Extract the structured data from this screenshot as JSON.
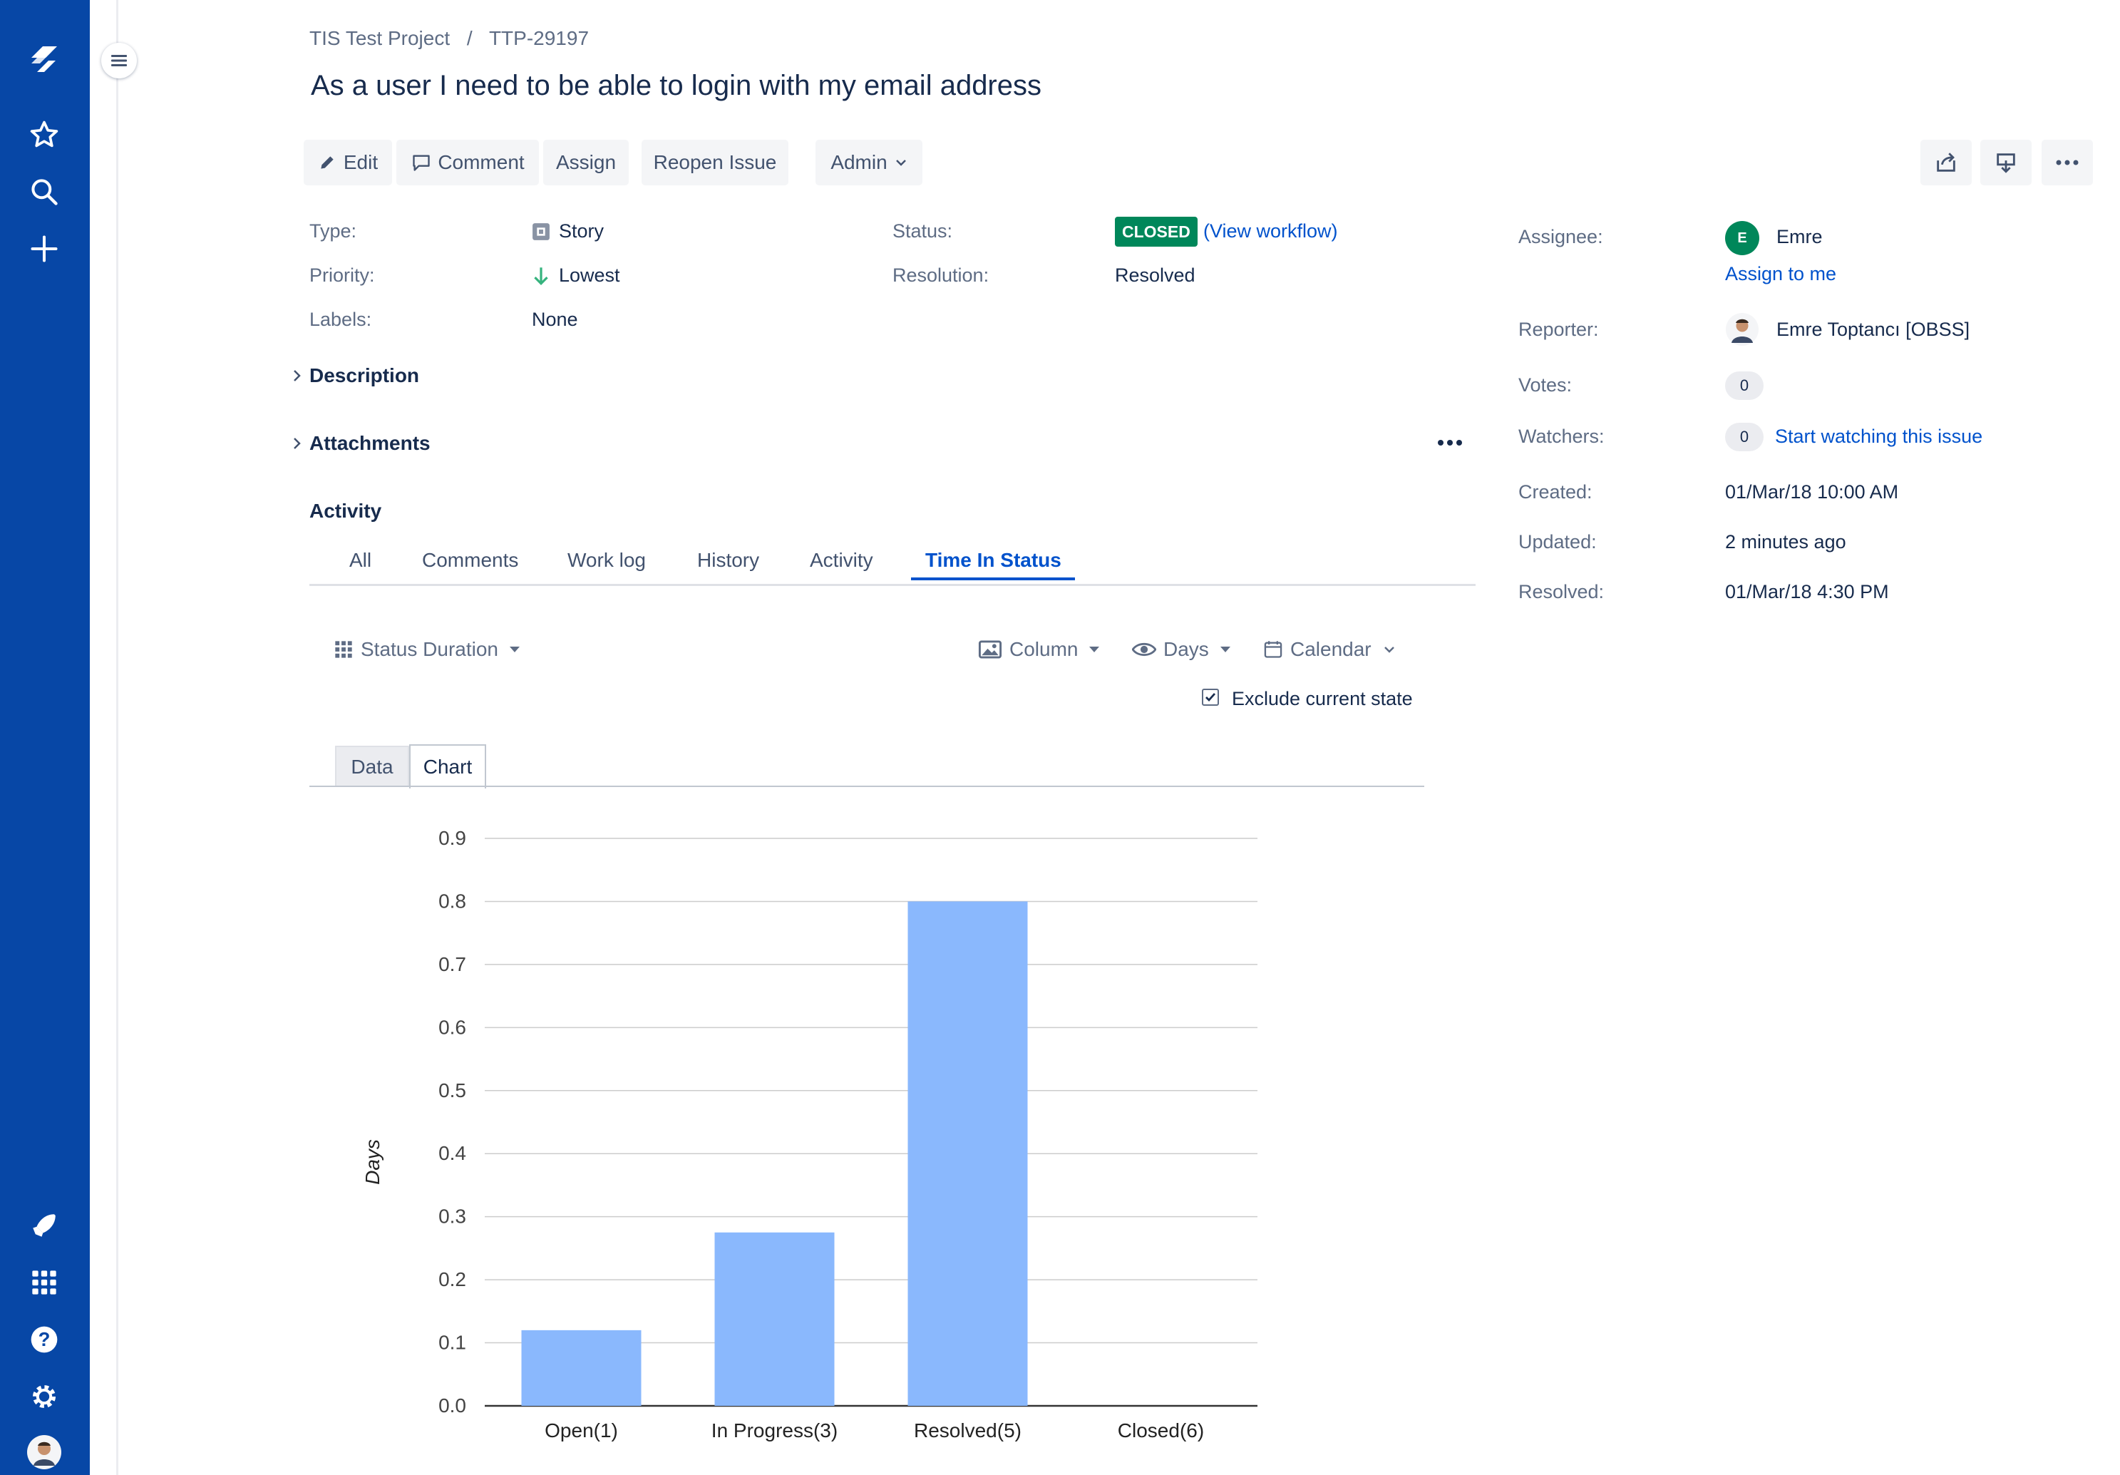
{
  "colors": {
    "nav_bg": "#0747a6",
    "link": "#0052cc",
    "closed_badge": "#00875a",
    "bar": "#8ab8fd",
    "assignee_avatar": "#00875a"
  },
  "nav": {
    "icons": [
      "jira-logo-icon",
      "star-icon",
      "search-icon",
      "plus-icon",
      "rocket-icon",
      "app-grid-icon",
      "help-icon",
      "gear-icon",
      "avatar"
    ]
  },
  "breadcrumb": {
    "project": "TIS Test Project",
    "separator": "/",
    "issue_key": "TTP-29197"
  },
  "issue": {
    "title": "As a user I need to be able to login with my email address"
  },
  "toolbar": {
    "edit": "Edit",
    "comment": "Comment",
    "assign": "Assign",
    "reopen": "Reopen Issue",
    "admin": "Admin"
  },
  "details": {
    "type_label": "Type:",
    "type_value": "Story",
    "priority_label": "Priority:",
    "priority_value": "Lowest",
    "labels_label": "Labels:",
    "labels_value": "None",
    "status_label": "Status:",
    "status_value": "CLOSED",
    "view_workflow": "(View workflow)",
    "resolution_label": "Resolution:",
    "resolution_value": "Resolved"
  },
  "sections": {
    "description": "Description",
    "attachments": "Attachments",
    "activity": "Activity"
  },
  "people": {
    "assignee_label": "Assignee:",
    "assignee_initial": "E",
    "assignee_name": "Emre",
    "assign_to_me": "Assign to me",
    "reporter_label": "Reporter:",
    "reporter_name": "Emre Toptancı [OBSS]",
    "votes_label": "Votes:",
    "votes_count": "0",
    "watchers_label": "Watchers:",
    "watchers_count": "0",
    "start_watching": "Start watching this issue"
  },
  "dates": {
    "created_label": "Created:",
    "created_value": "01/Mar/18 10:00 AM",
    "updated_label": "Updated:",
    "updated_value": "2 minutes ago",
    "resolved_label": "Resolved:",
    "resolved_value": "01/Mar/18 4:30 PM"
  },
  "activity_tabs": [
    "All",
    "Comments",
    "Work log",
    "History",
    "Activity",
    "Time In Status"
  ],
  "active_tab": "Time In Status",
  "tis": {
    "status_duration": "Status Duration",
    "column": "Column",
    "days": "Days",
    "calendar": "Calendar",
    "exclude_current_state": "Exclude current state",
    "exclude_checked": true,
    "view_tabs": [
      "Data",
      "Chart"
    ],
    "active_view": "Chart"
  },
  "chart_data": {
    "type": "bar",
    "categories": [
      "Open(1)",
      "In Progress(3)",
      "Resolved(5)",
      "Closed(6)"
    ],
    "values": [
      0.12,
      0.275,
      0.8,
      0
    ],
    "xlabel": "",
    "ylabel": "Days",
    "ylim": [
      0,
      0.9
    ],
    "yticks": [
      "0.0",
      "0.1",
      "0.2",
      "0.3",
      "0.4",
      "0.5",
      "0.6",
      "0.7",
      "0.8",
      "0.9"
    ],
    "grid": true
  }
}
